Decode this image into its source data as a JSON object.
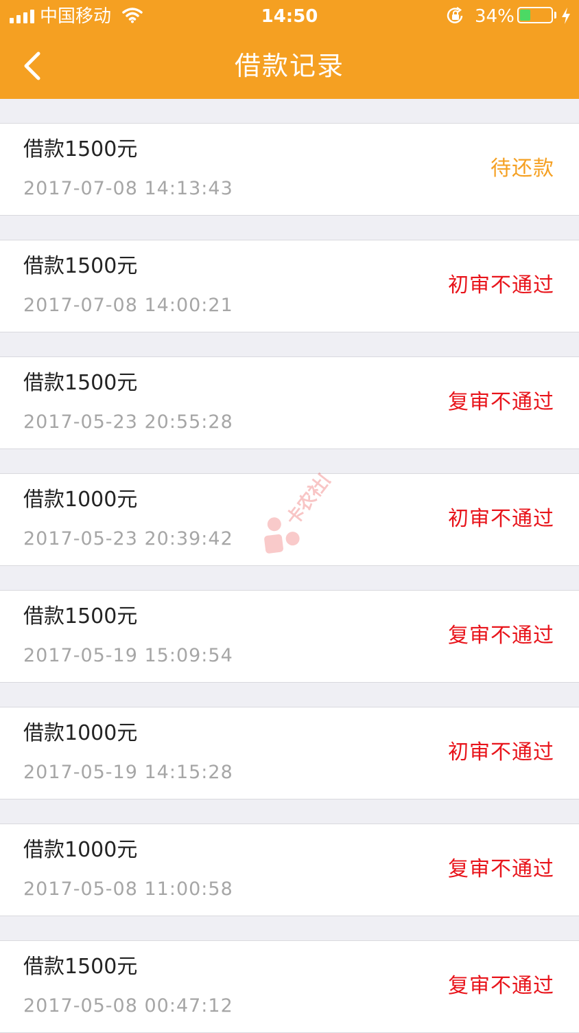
{
  "status_bar": {
    "carrier": "中国移动",
    "time": "14:50",
    "battery": "34%",
    "battery_level": 0.34
  },
  "header": {
    "title": "借款记录"
  },
  "colors": {
    "header_bg": "#f5a022",
    "pending": "#f5a022",
    "rejected": "#e8141b",
    "date": "#a6a6a6"
  },
  "records": [
    {
      "amount": "借款1500元",
      "time": "2017-07-08 14:13:43",
      "status": "待还款",
      "status_type": "pending"
    },
    {
      "amount": "借款1500元",
      "time": "2017-07-08 14:00:21",
      "status": "初审不通过",
      "status_type": "rejected"
    },
    {
      "amount": "借款1500元",
      "time": "2017-05-23 20:55:28",
      "status": "复审不通过",
      "status_type": "rejected"
    },
    {
      "amount": "借款1000元",
      "time": "2017-05-23 20:39:42",
      "status": "初审不通过",
      "status_type": "rejected"
    },
    {
      "amount": "借款1500元",
      "time": "2017-05-19 15:09:54",
      "status": "复审不通过",
      "status_type": "rejected"
    },
    {
      "amount": "借款1000元",
      "time": "2017-05-19 14:15:28",
      "status": "初审不通过",
      "status_type": "rejected"
    },
    {
      "amount": "借款1000元",
      "time": "2017-05-08 11:00:58",
      "status": "复审不通过",
      "status_type": "rejected"
    },
    {
      "amount": "借款1500元",
      "time": "2017-05-08 00:47:12",
      "status": "复审不通过",
      "status_type": "rejected"
    }
  ],
  "watermark": "卡农社区"
}
